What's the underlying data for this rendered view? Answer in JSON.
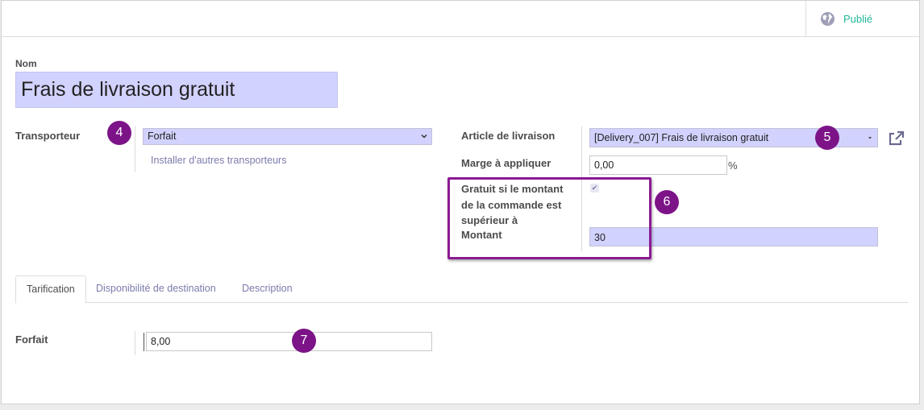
{
  "topbar": {
    "publish_label": "Publié",
    "publish_icon": "globe-icon"
  },
  "form": {
    "name_label": "Nom",
    "name_value": "Frais de livraison gratuit",
    "carrier_label": "Transporteur",
    "carrier_value": "Forfait",
    "install_link": "Installer d'autres transporteurs",
    "product_label": "Article de livraison",
    "product_value": "[Delivery_007] Frais de livraison gratuit",
    "margin_label": "Marge à appliquer",
    "margin_value": "0,00",
    "margin_unit": "%",
    "free_over_label_1": "Gratuit si le montant",
    "free_over_label_2": "de la commande est",
    "free_over_label_3": "supérieur à",
    "free_over_checked": true,
    "amount_label": "Montant",
    "amount_value": "30"
  },
  "tabs": [
    {
      "label": "Tarification",
      "active": true
    },
    {
      "label": "Disponibilité de destination",
      "active": false
    },
    {
      "label": "Description",
      "active": false
    }
  ],
  "pricing": {
    "fixed_label": "Forfait",
    "fixed_value": "8,00"
  },
  "annotations": {
    "b4": "4",
    "b5": "5",
    "b6": "6",
    "b7": "7"
  },
  "colors": {
    "accent": "#7c7bad",
    "required_bg": "#d2d2ff",
    "badge": "#7c1488",
    "published": "#21b799"
  }
}
